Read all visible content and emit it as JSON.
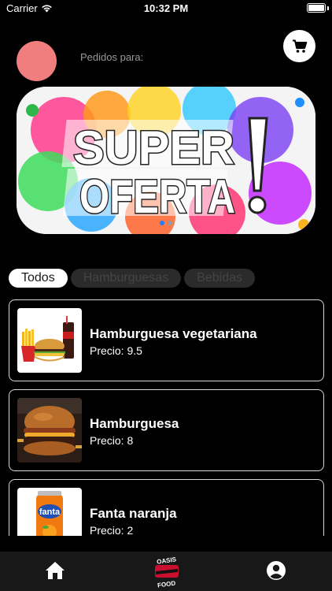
{
  "status": {
    "carrier": "Carrier",
    "time": "10:32 PM",
    "battery_level": 1.0
  },
  "header": {
    "label": "Pedidos para:",
    "avatar_color": "#f07e7e"
  },
  "banner": {
    "line1": "SUPER",
    "line2": "OFERTA",
    "active_dot": 0
  },
  "filters": [
    {
      "label": "Todos",
      "active": true
    },
    {
      "label": "Hamburguesas",
      "active": false
    },
    {
      "label": "Bebidas",
      "active": false
    }
  ],
  "products": [
    {
      "name": "Hamburguesa vegetariana",
      "price_label": "Precio: 9.5",
      "icon": "combo-meal-image"
    },
    {
      "name": "Hamburguesa",
      "price_label": "Precio: 8",
      "icon": "burger-image"
    },
    {
      "name": "Fanta naranja",
      "price_label": "Precio: 2",
      "icon": "fanta-can-image"
    }
  ],
  "tabbar": {
    "home_icon": "home-icon",
    "logo_text_top": "OASIS",
    "logo_text_bottom": "FOOD",
    "profile_icon": "profile-icon"
  },
  "colors": {
    "background": "#000000",
    "tabbar": "#181818",
    "chip_active": "#ffffff",
    "chip_inactive": "#2b2b2b"
  }
}
